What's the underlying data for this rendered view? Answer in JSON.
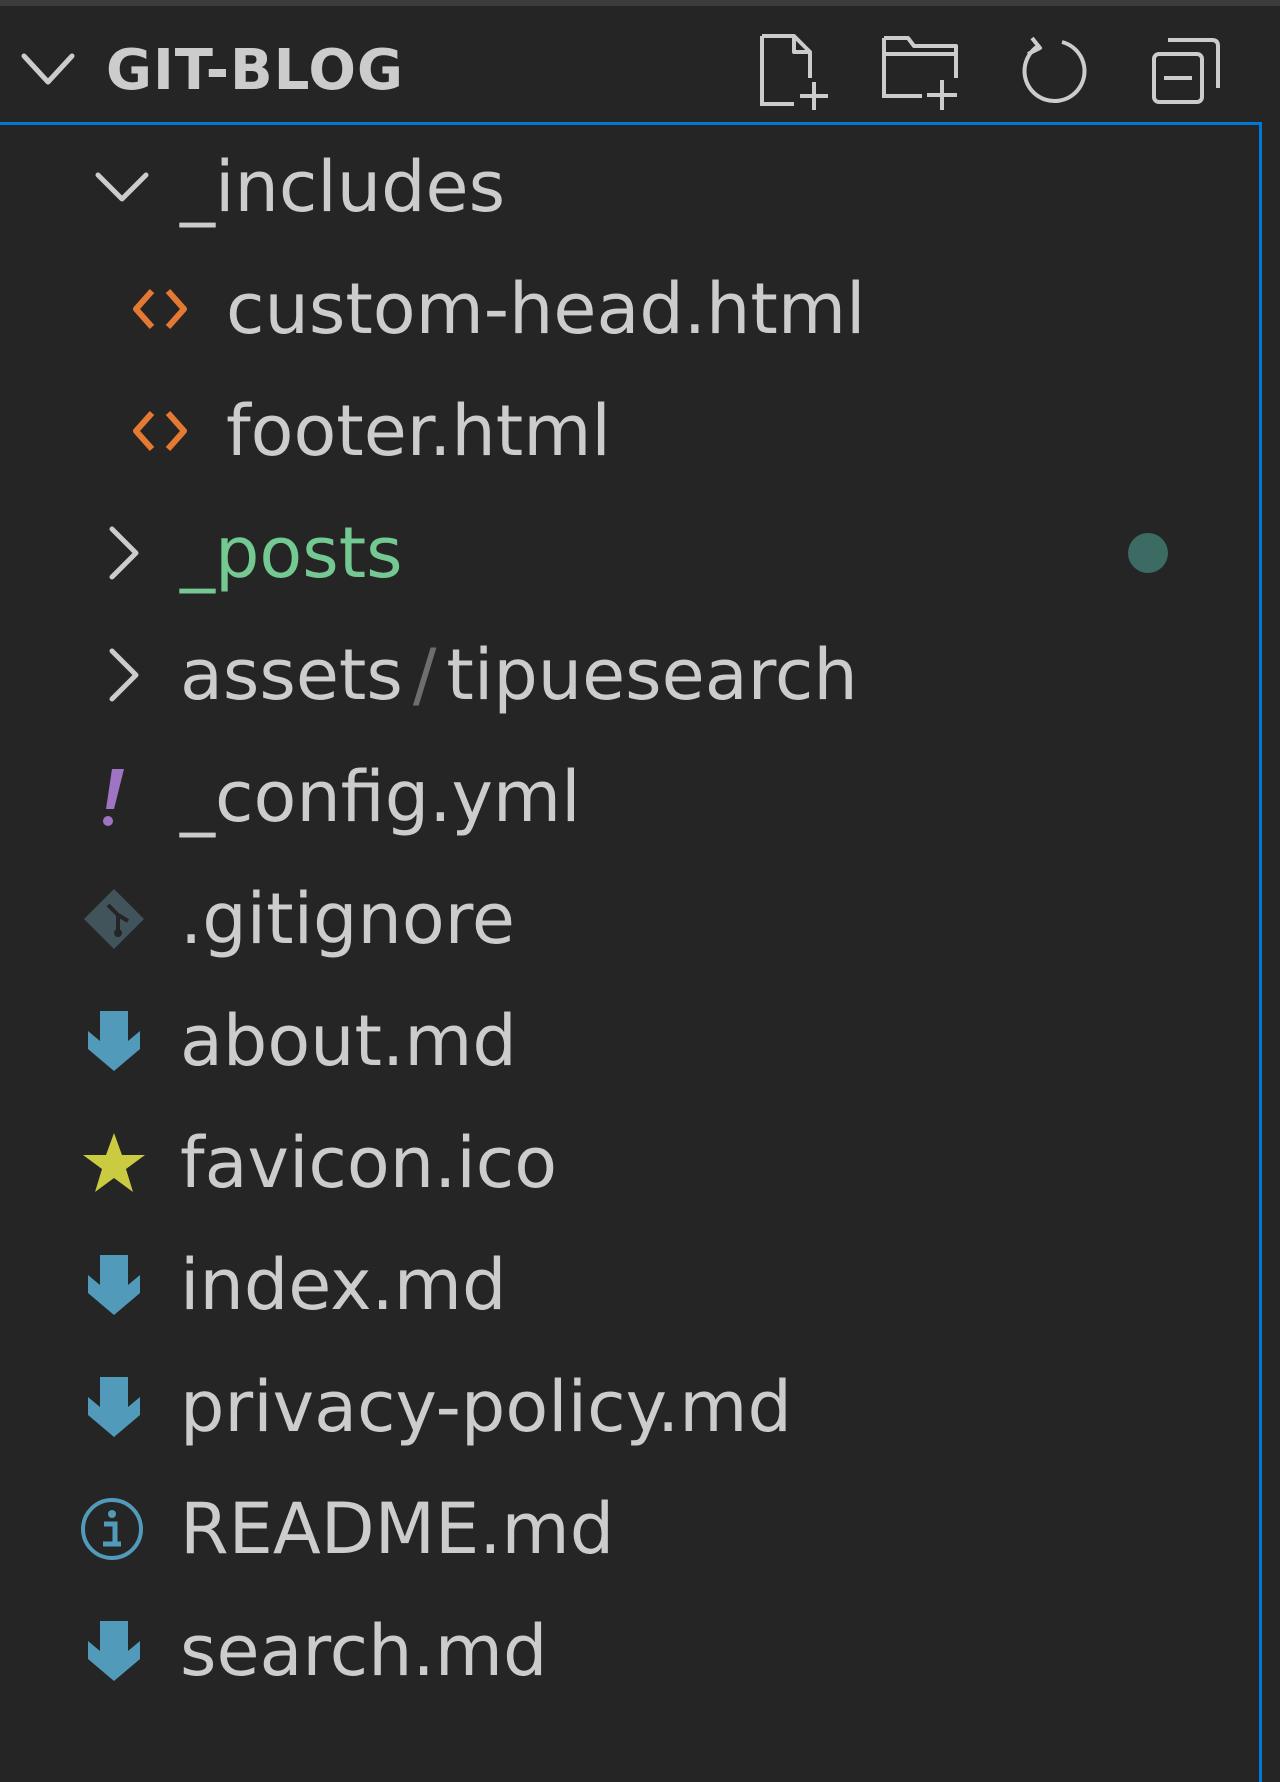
{
  "explorer": {
    "title": "GIT-BLOG",
    "actions": [
      {
        "name": "new-file-icon"
      },
      {
        "name": "new-folder-icon"
      },
      {
        "name": "refresh-icon"
      },
      {
        "name": "collapse-all-icon"
      }
    ]
  },
  "tree": [
    {
      "label": "_includes",
      "type": "folder",
      "expanded": true,
      "depth": 1
    },
    {
      "label": "custom-head.html",
      "type": "html-file",
      "depth": 2
    },
    {
      "label": "footer.html",
      "type": "html-file",
      "depth": 2
    },
    {
      "label": "_posts",
      "type": "folder",
      "expanded": false,
      "depth": 1,
      "git_status": "modified-dot",
      "status_color": "#73c991"
    },
    {
      "label_a": "assets",
      "sep": "/",
      "label_b": "tipuesearch",
      "type": "folder-compact",
      "expanded": false,
      "depth": 1
    },
    {
      "label": "_config.yml",
      "type": "yaml-file",
      "depth": 1
    },
    {
      "label": ".gitignore",
      "type": "git-file",
      "depth": 1
    },
    {
      "label": "about.md",
      "type": "markdown-file",
      "depth": 1
    },
    {
      "label": "favicon.ico",
      "type": "ico-file",
      "depth": 1
    },
    {
      "label": "index.md",
      "type": "markdown-file",
      "depth": 1
    },
    {
      "label": "privacy-policy.md",
      "type": "markdown-file",
      "depth": 1
    },
    {
      "label": "README.md",
      "type": "readme-file",
      "depth": 1
    },
    {
      "label": "search.md",
      "type": "markdown-file",
      "depth": 1
    }
  ],
  "colors": {
    "background": "#252526",
    "focus_border": "#0078d4",
    "html_icon": "#e37933",
    "yaml_icon": "#a074c4",
    "markdown_icon": "#519aba",
    "ico_icon": "#cbcb41",
    "git_icon": "#41535b",
    "git_added_text": "#73c991"
  }
}
